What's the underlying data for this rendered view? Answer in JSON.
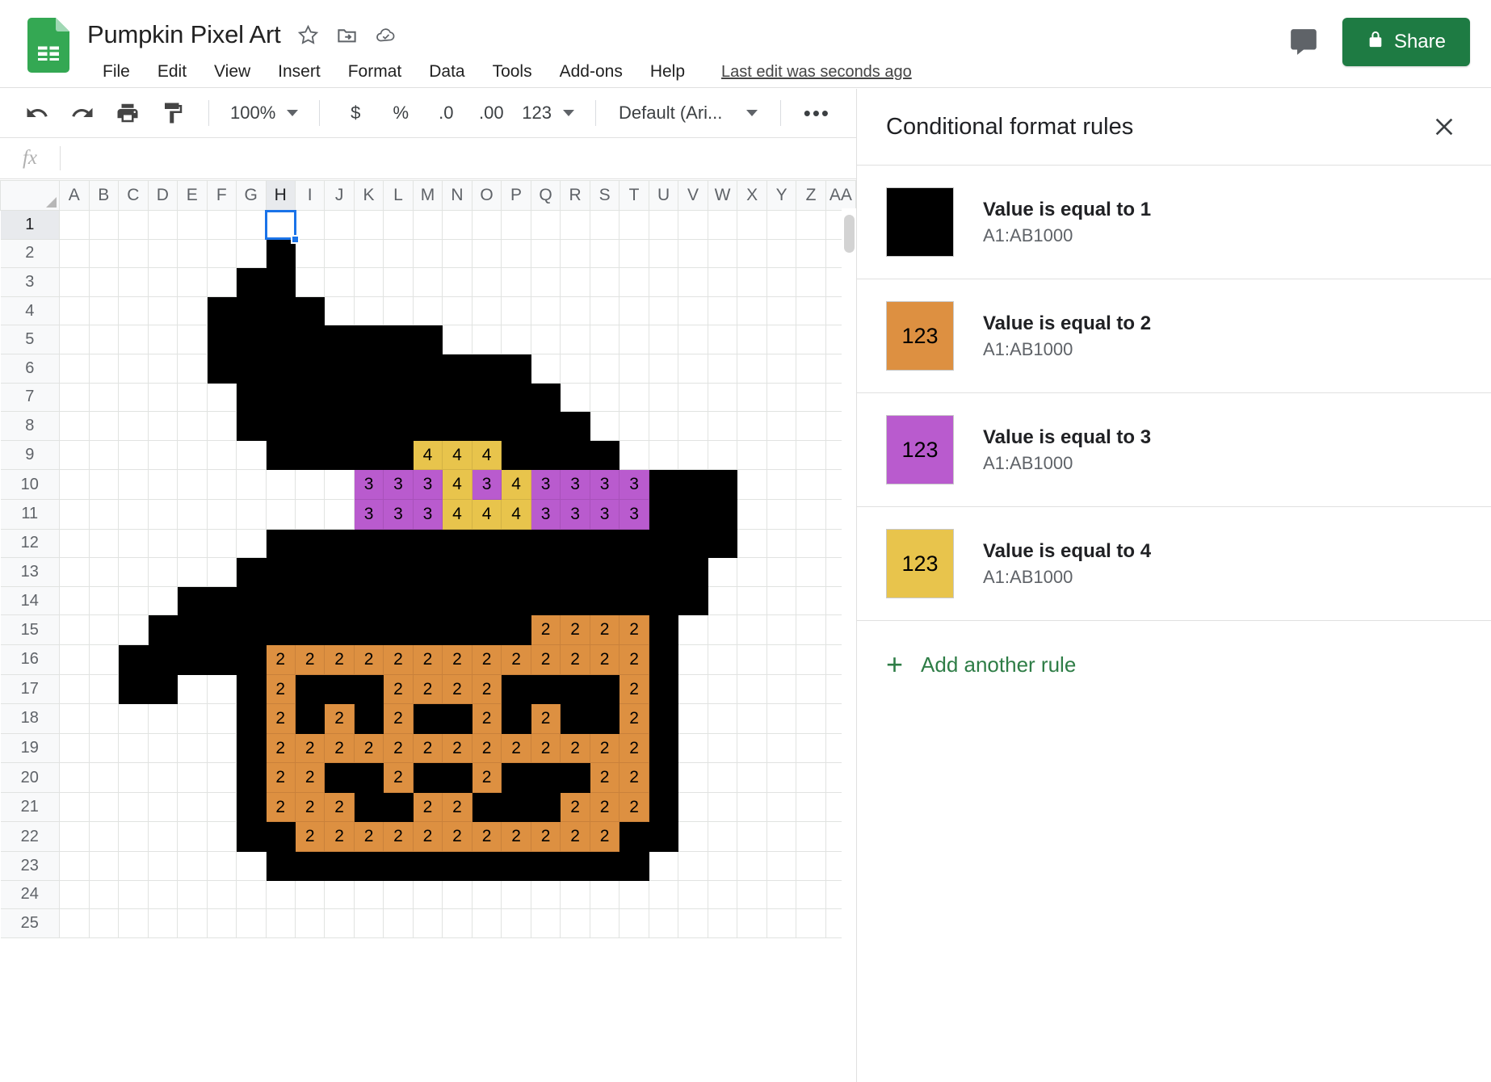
{
  "app": {
    "logo_icon": "sheets-logo-icon",
    "doc_title": "Pumpkin Pixel Art",
    "title_icons": [
      {
        "name": "star-icon",
        "label": "Star"
      },
      {
        "name": "move-to-folder-icon",
        "label": "Move"
      },
      {
        "name": "cloud-saved-icon",
        "label": "Saved to Drive"
      }
    ],
    "menus": [
      "File",
      "Edit",
      "View",
      "Insert",
      "Format",
      "Data",
      "Tools",
      "Add-ons",
      "Help"
    ],
    "last_edit": "Last edit was seconds ago",
    "comment_icon": "comment-icon",
    "share": {
      "label": "Share",
      "icon": "lock-icon",
      "color": "#1e7b43"
    }
  },
  "toolbar": {
    "items": [
      {
        "name": "undo-icon",
        "type": "icon"
      },
      {
        "name": "redo-icon",
        "type": "icon"
      },
      {
        "name": "print-icon",
        "type": "icon"
      },
      {
        "name": "paint-format-icon",
        "type": "icon"
      }
    ],
    "zoom_value": "100%",
    "currency_label": "$",
    "percent_label": "%",
    "decrease_decimal_label": ".0",
    "increase_decimal_label": ".00",
    "number_format_label": "123",
    "font_value": "Default (Ari...",
    "more_label": "•••",
    "collapse_icon": "chevron-up-icon"
  },
  "formula_bar": {
    "fx_label": "fx",
    "value": "",
    "placeholder": ""
  },
  "sheet": {
    "columns": [
      "A",
      "B",
      "C",
      "D",
      "E",
      "F",
      "G",
      "H",
      "I",
      "J",
      "K",
      "L",
      "M",
      "N",
      "O",
      "P",
      "Q",
      "R",
      "S",
      "T",
      "U",
      "V",
      "W",
      "X",
      "Y",
      "Z",
      "AA"
    ],
    "rows": [
      1,
      2,
      3,
      4,
      5,
      6,
      7,
      8,
      9,
      10,
      11,
      12,
      13,
      14,
      15,
      16,
      17,
      18,
      19,
      20,
      21,
      22,
      23,
      24,
      25
    ],
    "selected_cell": "H1",
    "selected_col": "H",
    "selected_row": 1,
    "colors": {
      "v1": "#000000",
      "v2": "#DD9041",
      "v3": "#B95BCE",
      "v4": "#E8C44C"
    },
    "cell_values": {
      "2": {
        "H": 1
      },
      "3": {
        "G": 1,
        "H": 1
      },
      "4": {
        "F": 1,
        "G": 1,
        "H": 1,
        "I": 1
      },
      "5": {
        "F": 1,
        "G": 1,
        "H": 1,
        "I": 1,
        "J": 1,
        "K": 1,
        "L": 1,
        "M": 1
      },
      "6": {
        "F": 1,
        "G": 1,
        "H": 1,
        "I": 1,
        "J": 1,
        "K": 1,
        "L": 1,
        "M": 1,
        "N": 1,
        "O": 1,
        "P": 1
      },
      "7": {
        "G": 1,
        "H": 1,
        "I": 1,
        "J": 1,
        "K": 1,
        "L": 1,
        "M": 1,
        "N": 1,
        "O": 1,
        "P": 1,
        "Q": 1
      },
      "8": {
        "G": 1,
        "H": 1,
        "I": 1,
        "J": 1,
        "K": 1,
        "L": 1,
        "M": 1,
        "N": 1,
        "O": 1,
        "P": 1,
        "Q": 1,
        "R": 1
      },
      "9": {
        "H": 1,
        "I": 1,
        "J": 1,
        "K": 1,
        "L": 1,
        "M": 4,
        "N": 4,
        "O": 4,
        "P": 1,
        "Q": 1,
        "R": 1,
        "S": 1
      },
      "10": {
        "K": 3,
        "L": 3,
        "M": 3,
        "N": 4,
        "O": 3,
        "P": 4,
        "Q": 3,
        "R": 3,
        "S": 3,
        "T": 3,
        "U": 1,
        "V": 1,
        "W": 1
      },
      "11": {
        "K": 3,
        "L": 3,
        "M": 3,
        "N": 4,
        "O": 4,
        "P": 4,
        "Q": 3,
        "R": 3,
        "S": 3,
        "T": 3,
        "U": 1,
        "V": 1,
        "W": 1
      },
      "12": {
        "H": 1,
        "I": 1,
        "J": 1,
        "K": 1,
        "L": 1,
        "M": 1,
        "N": 1,
        "O": 1,
        "P": 1,
        "Q": 1,
        "R": 1,
        "S": 1,
        "T": 1,
        "U": 1,
        "V": 1,
        "W": 1
      },
      "13": {
        "G": 1,
        "H": 1,
        "I": 1,
        "J": 1,
        "K": 1,
        "L": 1,
        "M": 1,
        "N": 1,
        "O": 1,
        "P": 1,
        "Q": 1,
        "R": 1,
        "S": 1,
        "T": 1,
        "U": 1,
        "V": 1
      },
      "14": {
        "E": 1,
        "F": 1,
        "G": 1,
        "H": 1,
        "I": 1,
        "J": 1,
        "K": 1,
        "L": 1,
        "M": 1,
        "N": 1,
        "O": 1,
        "P": 1,
        "Q": 1,
        "R": 1,
        "S": 1,
        "T": 1,
        "U": 1,
        "V": 1
      },
      "15": {
        "D": 1,
        "E": 1,
        "F": 1,
        "G": 1,
        "H": 1,
        "I": 1,
        "J": 1,
        "K": 1,
        "L": 1,
        "M": 1,
        "N": 1,
        "O": 1,
        "P": 1,
        "Q": 2,
        "R": 2,
        "S": 2,
        "T": 2,
        "U": 1
      },
      "16": {
        "C": 1,
        "D": 1,
        "E": 1,
        "F": 1,
        "G": 1,
        "H": 2,
        "I": 2,
        "J": 2,
        "K": 2,
        "L": 2,
        "M": 2,
        "N": 2,
        "O": 2,
        "P": 2,
        "Q": 2,
        "R": 2,
        "S": 2,
        "T": 2,
        "U": 1
      },
      "17": {
        "C": 1,
        "D": 1,
        "G": 1,
        "H": 2,
        "I": 1,
        "J": 1,
        "K": 1,
        "L": 2,
        "M": 2,
        "N": 2,
        "O": 2,
        "P": 1,
        "Q": 1,
        "R": 1,
        "S": 1,
        "T": 2,
        "U": 1
      },
      "18": {
        "G": 1,
        "H": 2,
        "I": 1,
        "J": 2,
        "K": 1,
        "L": 2,
        "M": 1,
        "N": 1,
        "O": 2,
        "P": 1,
        "Q": 2,
        "R": 1,
        "S": 1,
        "T": 2,
        "U": 1
      },
      "19": {
        "G": 1,
        "H": 2,
        "I": 2,
        "J": 2,
        "K": 2,
        "L": 2,
        "M": 2,
        "N": 2,
        "O": 2,
        "P": 2,
        "Q": 2,
        "R": 2,
        "S": 2,
        "T": 2,
        "U": 1
      },
      "20": {
        "G": 1,
        "H": 2,
        "I": 2,
        "J": 1,
        "K": 1,
        "L": 2,
        "M": 1,
        "N": 1,
        "O": 2,
        "P": 1,
        "Q": 1,
        "R": 1,
        "S": 2,
        "T": 2,
        "U": 1
      },
      "21": {
        "G": 1,
        "H": 2,
        "I": 2,
        "J": 2,
        "K": 1,
        "L": 1,
        "M": 2,
        "N": 2,
        "O": 1,
        "P": 1,
        "Q": 1,
        "R": 2,
        "S": 2,
        "T": 2,
        "U": 1
      },
      "22": {
        "G": 1,
        "H": 1,
        "I": 2,
        "J": 2,
        "K": 2,
        "L": 2,
        "M": 2,
        "N": 2,
        "O": 2,
        "P": 2,
        "Q": 2,
        "R": 2,
        "S": 2,
        "T": 1,
        "U": 1
      },
      "23": {
        "H": 1,
        "I": 1,
        "J": 1,
        "K": 1,
        "L": 1,
        "M": 1,
        "N": 1,
        "O": 1,
        "P": 1,
        "Q": 1,
        "R": 1,
        "S": 1,
        "T": 1
      }
    }
  },
  "panel": {
    "title": "Conditional format rules",
    "close_icon": "close-icon",
    "rules": [
      {
        "swatch_text": "",
        "color": "#000000",
        "condition": "Value is equal to 1",
        "range": "A1:AB1000"
      },
      {
        "swatch_text": "123",
        "color": "#DD9041",
        "condition": "Value is equal to 2",
        "range": "A1:AB1000"
      },
      {
        "swatch_text": "123",
        "color": "#B95BCE",
        "condition": "Value is equal to 3",
        "range": "A1:AB1000"
      },
      {
        "swatch_text": "123",
        "color": "#E8C44C",
        "condition": "Value is equal to 4",
        "range": "A1:AB1000"
      }
    ],
    "add_rule_label": "Add another rule",
    "add_rule_icon": "plus-icon"
  }
}
